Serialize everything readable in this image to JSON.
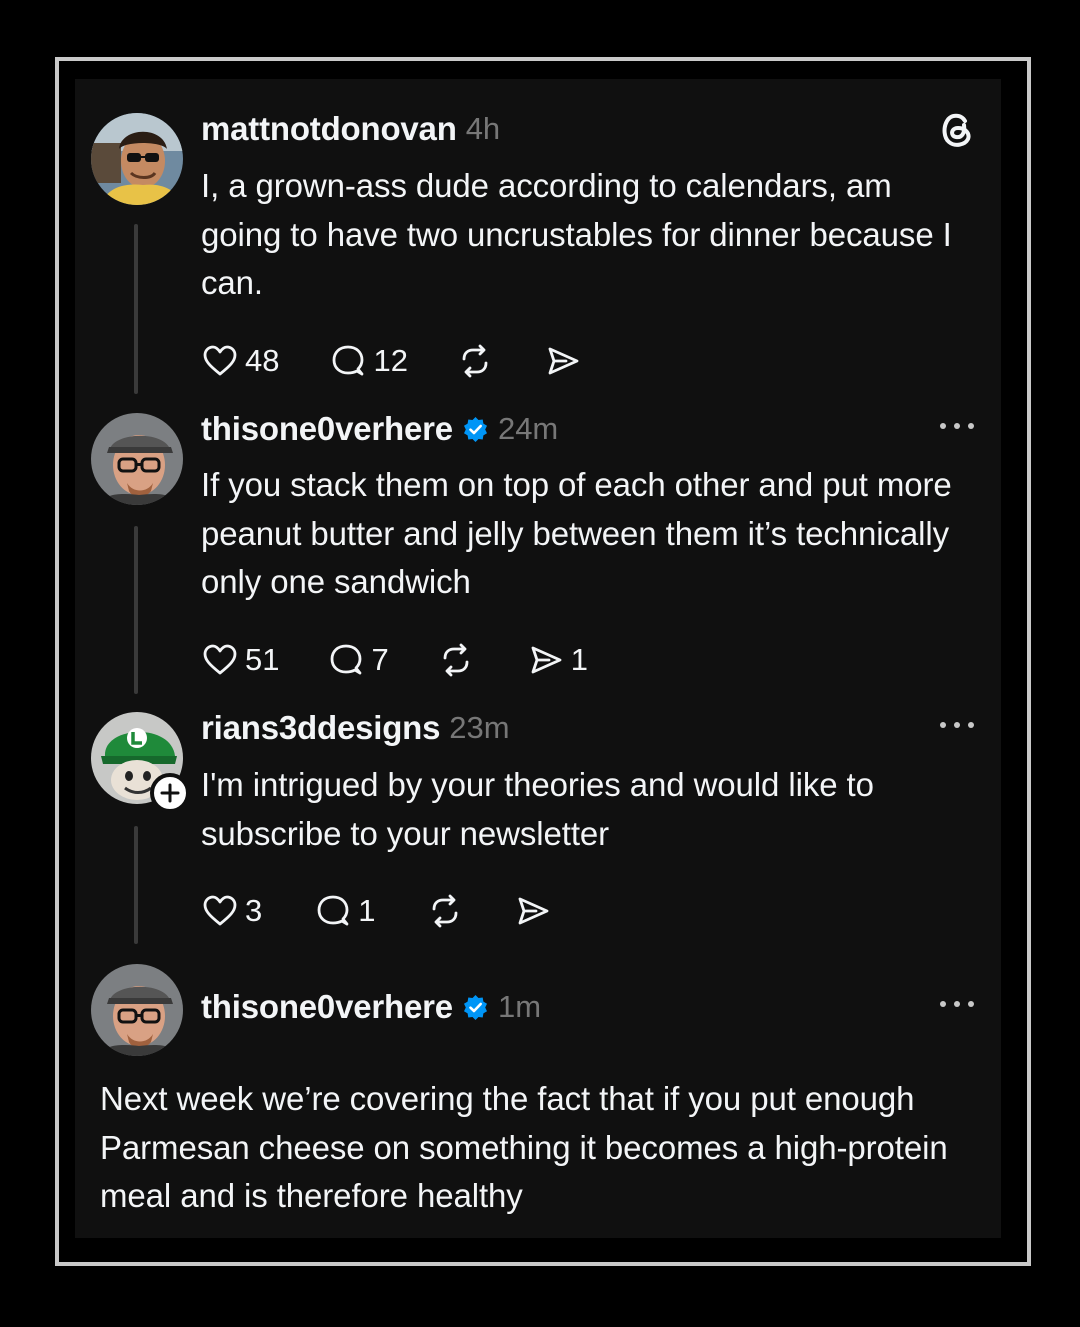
{
  "app": {
    "logo_icon": "threads-logo-icon"
  },
  "colors": {
    "background": "#000000",
    "card": "#101010",
    "frame": "#c9c9c9",
    "text": "#f3f5f7",
    "muted": "#777777",
    "verified": "#0095f6"
  },
  "posts": [
    {
      "username": "mattnotdonovan",
      "time": "4h",
      "verified": false,
      "text": "I, a grown-ass dude according to calendars, am going to have two uncrustables for dinner because I can.",
      "likes": "48",
      "replies": "12",
      "reposts": "",
      "shares": ""
    },
    {
      "username": "thisone0verhere",
      "time": "24m",
      "verified": true,
      "text": "If you stack them on top of each other and put more peanut butter and jelly between them it’s technically only one sandwich",
      "likes": "51",
      "replies": "7",
      "reposts": "",
      "shares": "1"
    },
    {
      "username": "rians3ddesigns",
      "time": "23m",
      "verified": false,
      "text": "I'm intrigued by your theories and would like to subscribe to your newsletter",
      "likes": "3",
      "replies": "1",
      "reposts": "",
      "shares": ""
    },
    {
      "username": "thisone0verhere",
      "time": "1m",
      "verified": true,
      "text": "Next week we’re covering the fact that if you put enough Parmesan cheese on something it becomes a high-protein meal and is therefore healthy"
    }
  ]
}
